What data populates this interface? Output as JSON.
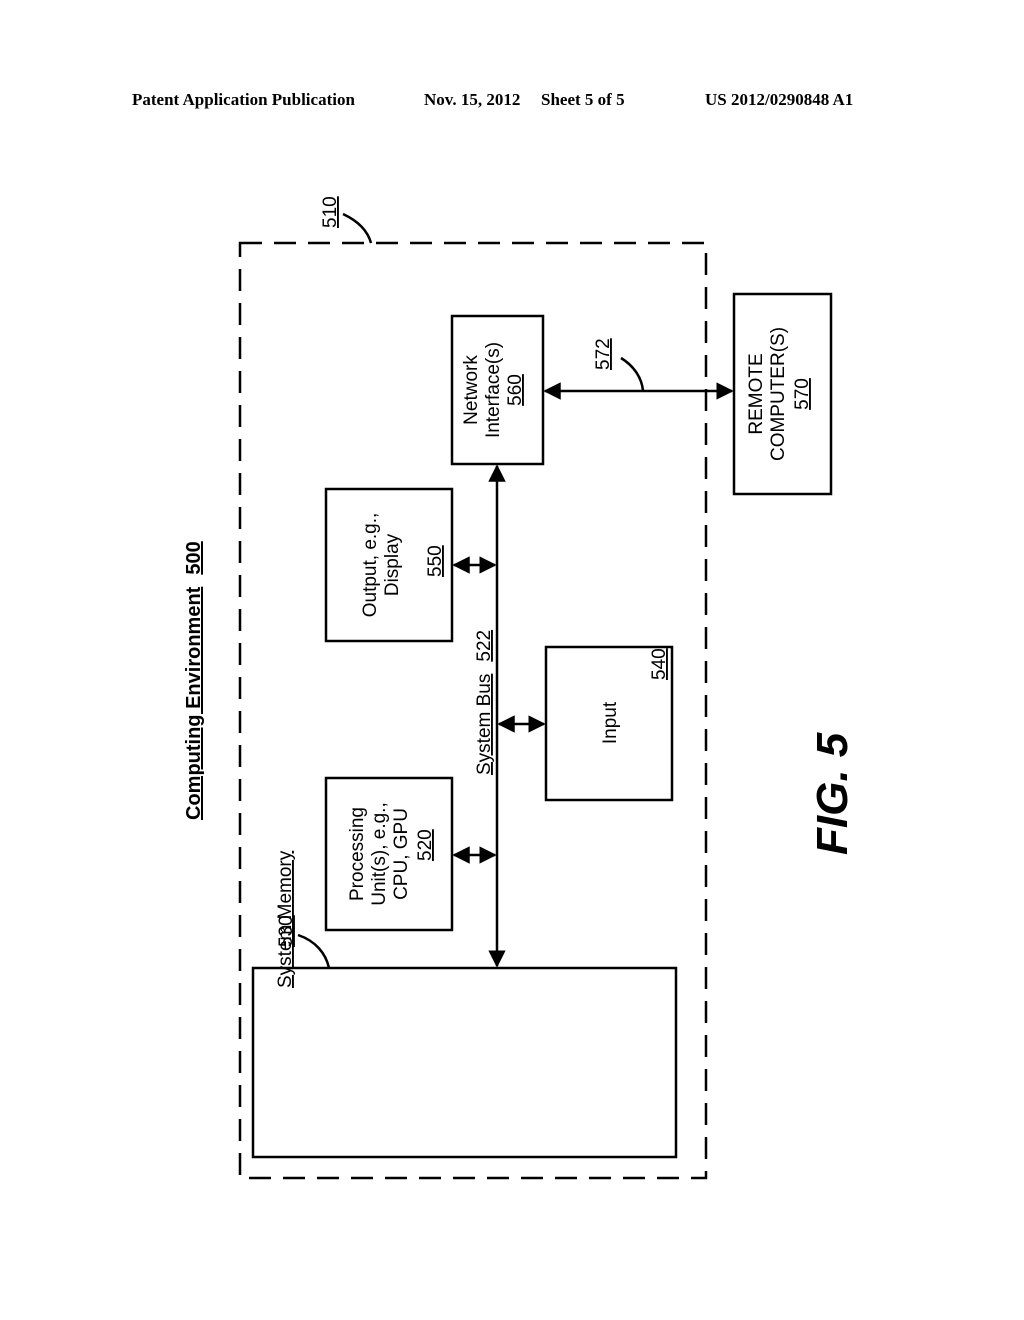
{
  "header": {
    "publication": "Patent Application Publication",
    "date": "Nov. 15, 2012",
    "sheet": "Sheet 5 of 5",
    "number": "US 2012/0290848 A1"
  },
  "diagram": {
    "title": "Computing Environment",
    "title_ref": "500",
    "outer_ref": "510",
    "system_memory": {
      "label": "System Memory",
      "ref": "530"
    },
    "processing": {
      "lines": [
        "Processing",
        "Unit(s), e.g.,",
        "CPU, GPU"
      ],
      "ref": "520"
    },
    "system_bus": {
      "label": "System Bus",
      "ref": "522"
    },
    "output": {
      "lines": [
        "Output, e.g.,",
        "Display"
      ],
      "ref": "550"
    },
    "input": {
      "label": "Input",
      "ref": "540"
    },
    "network": {
      "lines": [
        "Network",
        "Interface(s)"
      ],
      "ref": "560"
    },
    "connection": {
      "ref": "572"
    },
    "remote": {
      "lines": [
        "REMOTE",
        "COMPUTER(S)"
      ],
      "ref": "570"
    },
    "figure_label": "FIG. 5"
  }
}
